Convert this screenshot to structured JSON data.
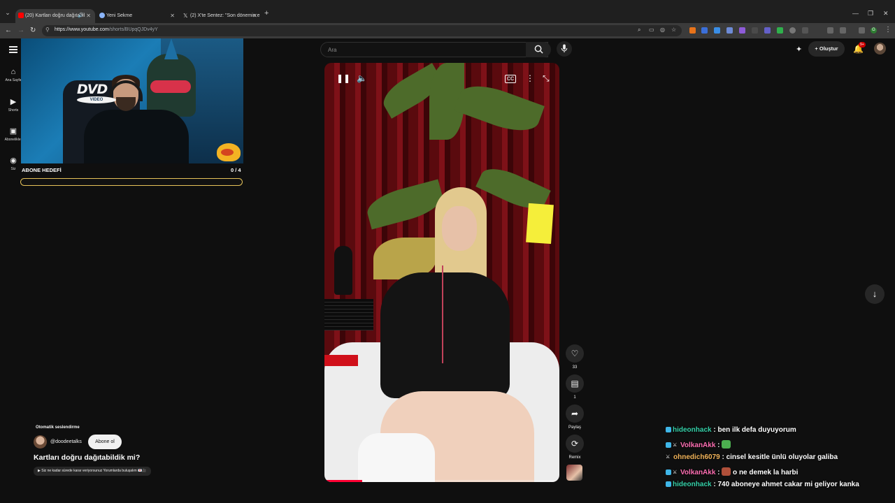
{
  "browser": {
    "tabs": [
      {
        "label": "(20) Kartları doğru dağıtabil",
        "favicon_color": "#ff0000",
        "active": true
      },
      {
        "label": "Yeni Sekme",
        "favicon_color": "#8ab4f8",
        "active": false
      },
      {
        "label": "(2) X'te Sentez: \"Son dönemin e",
        "favicon_color": "#ffffff",
        "active": false
      }
    ],
    "url_host": "https://www.youtube.com",
    "url_path": "/shorts/BUpqQJDv4yY",
    "profile_initial": "G"
  },
  "youtube": {
    "search_placeholder": "Ara",
    "create_label": "Oluştur",
    "notif_badge": "9+",
    "sidebar": [
      {
        "label": "Ana Sayfa",
        "icon": "home-icon"
      },
      {
        "label": "Shorts",
        "icon": "shorts-icon"
      },
      {
        "label": "Abonelikler",
        "icon": "subscriptions-icon"
      },
      {
        "label": "Siz",
        "icon": "user-icon"
      }
    ],
    "actions": {
      "likes": "33",
      "comments": "1",
      "share": "Paylaş",
      "remix": "Remix"
    },
    "video": {
      "progress": 0.16,
      "auto_dub": "Otomatik seslendirme",
      "channel": "@doodeetalks",
      "subscribe": "Abone ol",
      "title": "Kartları doğru dağıtabildik mi?",
      "pill": "▶ Siz ne kadar sürede karar veriyorsunuz Yorumlarda buluşalım 💌🎥"
    }
  },
  "stream": {
    "dvd_text": "DVD",
    "dvd_sub": "VIDEO",
    "goal_title": "ABONE HEDEFİ",
    "goal_count": "0 / 4",
    "goal_progress": 0,
    "goal_color": "#e6c35a"
  },
  "chat": [
    {
      "user": "hideonhack",
      "color": "#35d0a8",
      "message": ": ben ilk defa duyuyorum",
      "badge": "#3fb6e8",
      "sword": false,
      "emote": null
    },
    {
      "user": "VolkanAkk",
      "color": "#ff6fb3",
      "message": "",
      "badge": "#3fb6e8",
      "sword": true,
      "emote": "#4caf50"
    },
    {
      "user": "ohnedich6079",
      "color": "#f2b45a",
      "message": ": cinsel kesitle ünlü oluyolar galiba",
      "badge": null,
      "sword": true,
      "emote": null
    },
    {
      "user": "VolkanAkk",
      "color": "#ff6fb3",
      "message": "o ne demek la harbi",
      "badge": "#3fb6e8",
      "sword": true,
      "emote": "#b0503a"
    },
    {
      "user": "hideonhack",
      "color": "#35d0a8",
      "message": ": 740 aboneye ahmet cakar mi geliyor kanka",
      "badge": "#3fb6e8",
      "sword": false,
      "emote": null
    }
  ]
}
